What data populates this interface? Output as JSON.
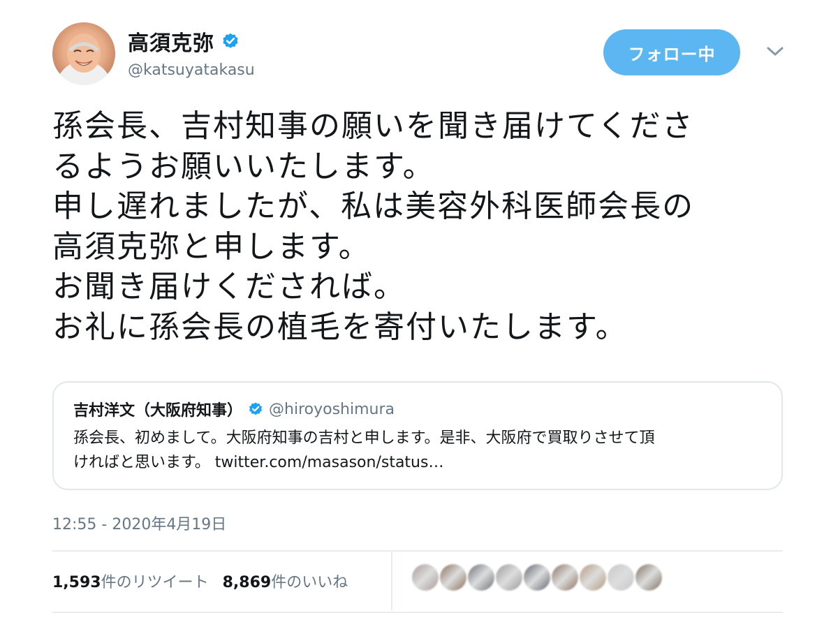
{
  "author": {
    "display_name": "高須克弥",
    "handle": "@katsuyatakasu",
    "verified": true,
    "avatar_icon": "user-avatar"
  },
  "follow_button": {
    "label": "フォロー中",
    "color": "#5bb6f1"
  },
  "menu_icon": "chevron-down-icon",
  "tweet": {
    "lines": [
      "孫会長、吉村知事の願いを聞き届けてくださ",
      "るようお願いいたします。",
      "申し遅れましたが、私は美容外科医師会長の",
      "高須克弥と申します。",
      "お聞き届けくだされば。",
      "お礼に孫会長の植毛を寄付いたします。"
    ]
  },
  "quoted_tweet": {
    "display_name": "吉村洋文（大阪府知事）",
    "handle": "@hiroyoshimura",
    "verified": true,
    "lines": [
      "孫会長、初めまして。大阪府知事の吉村と申します。是非、大阪府で買取りさせて頂",
      "ければと思います。 twitter.com/masason/status…"
    ]
  },
  "timestamp": "12:55 - 2020年4月19日",
  "stats": {
    "retweets_count": "1,593",
    "retweets_label": "件のリツイート",
    "likes_count": "8,869",
    "likes_label": "件のいいね"
  },
  "likers": [
    "#a89a97",
    "#8a6d5a",
    "#6b6f76",
    "#9a9a9a",
    "#5f6670",
    "#8b7360",
    "#b39a7e",
    "#c7c7c7",
    "#7d6f60"
  ],
  "colors": {
    "accent": "#1da1f2",
    "text": "#14171a",
    "secondary": "#657786",
    "border": "#e1e8ed"
  }
}
